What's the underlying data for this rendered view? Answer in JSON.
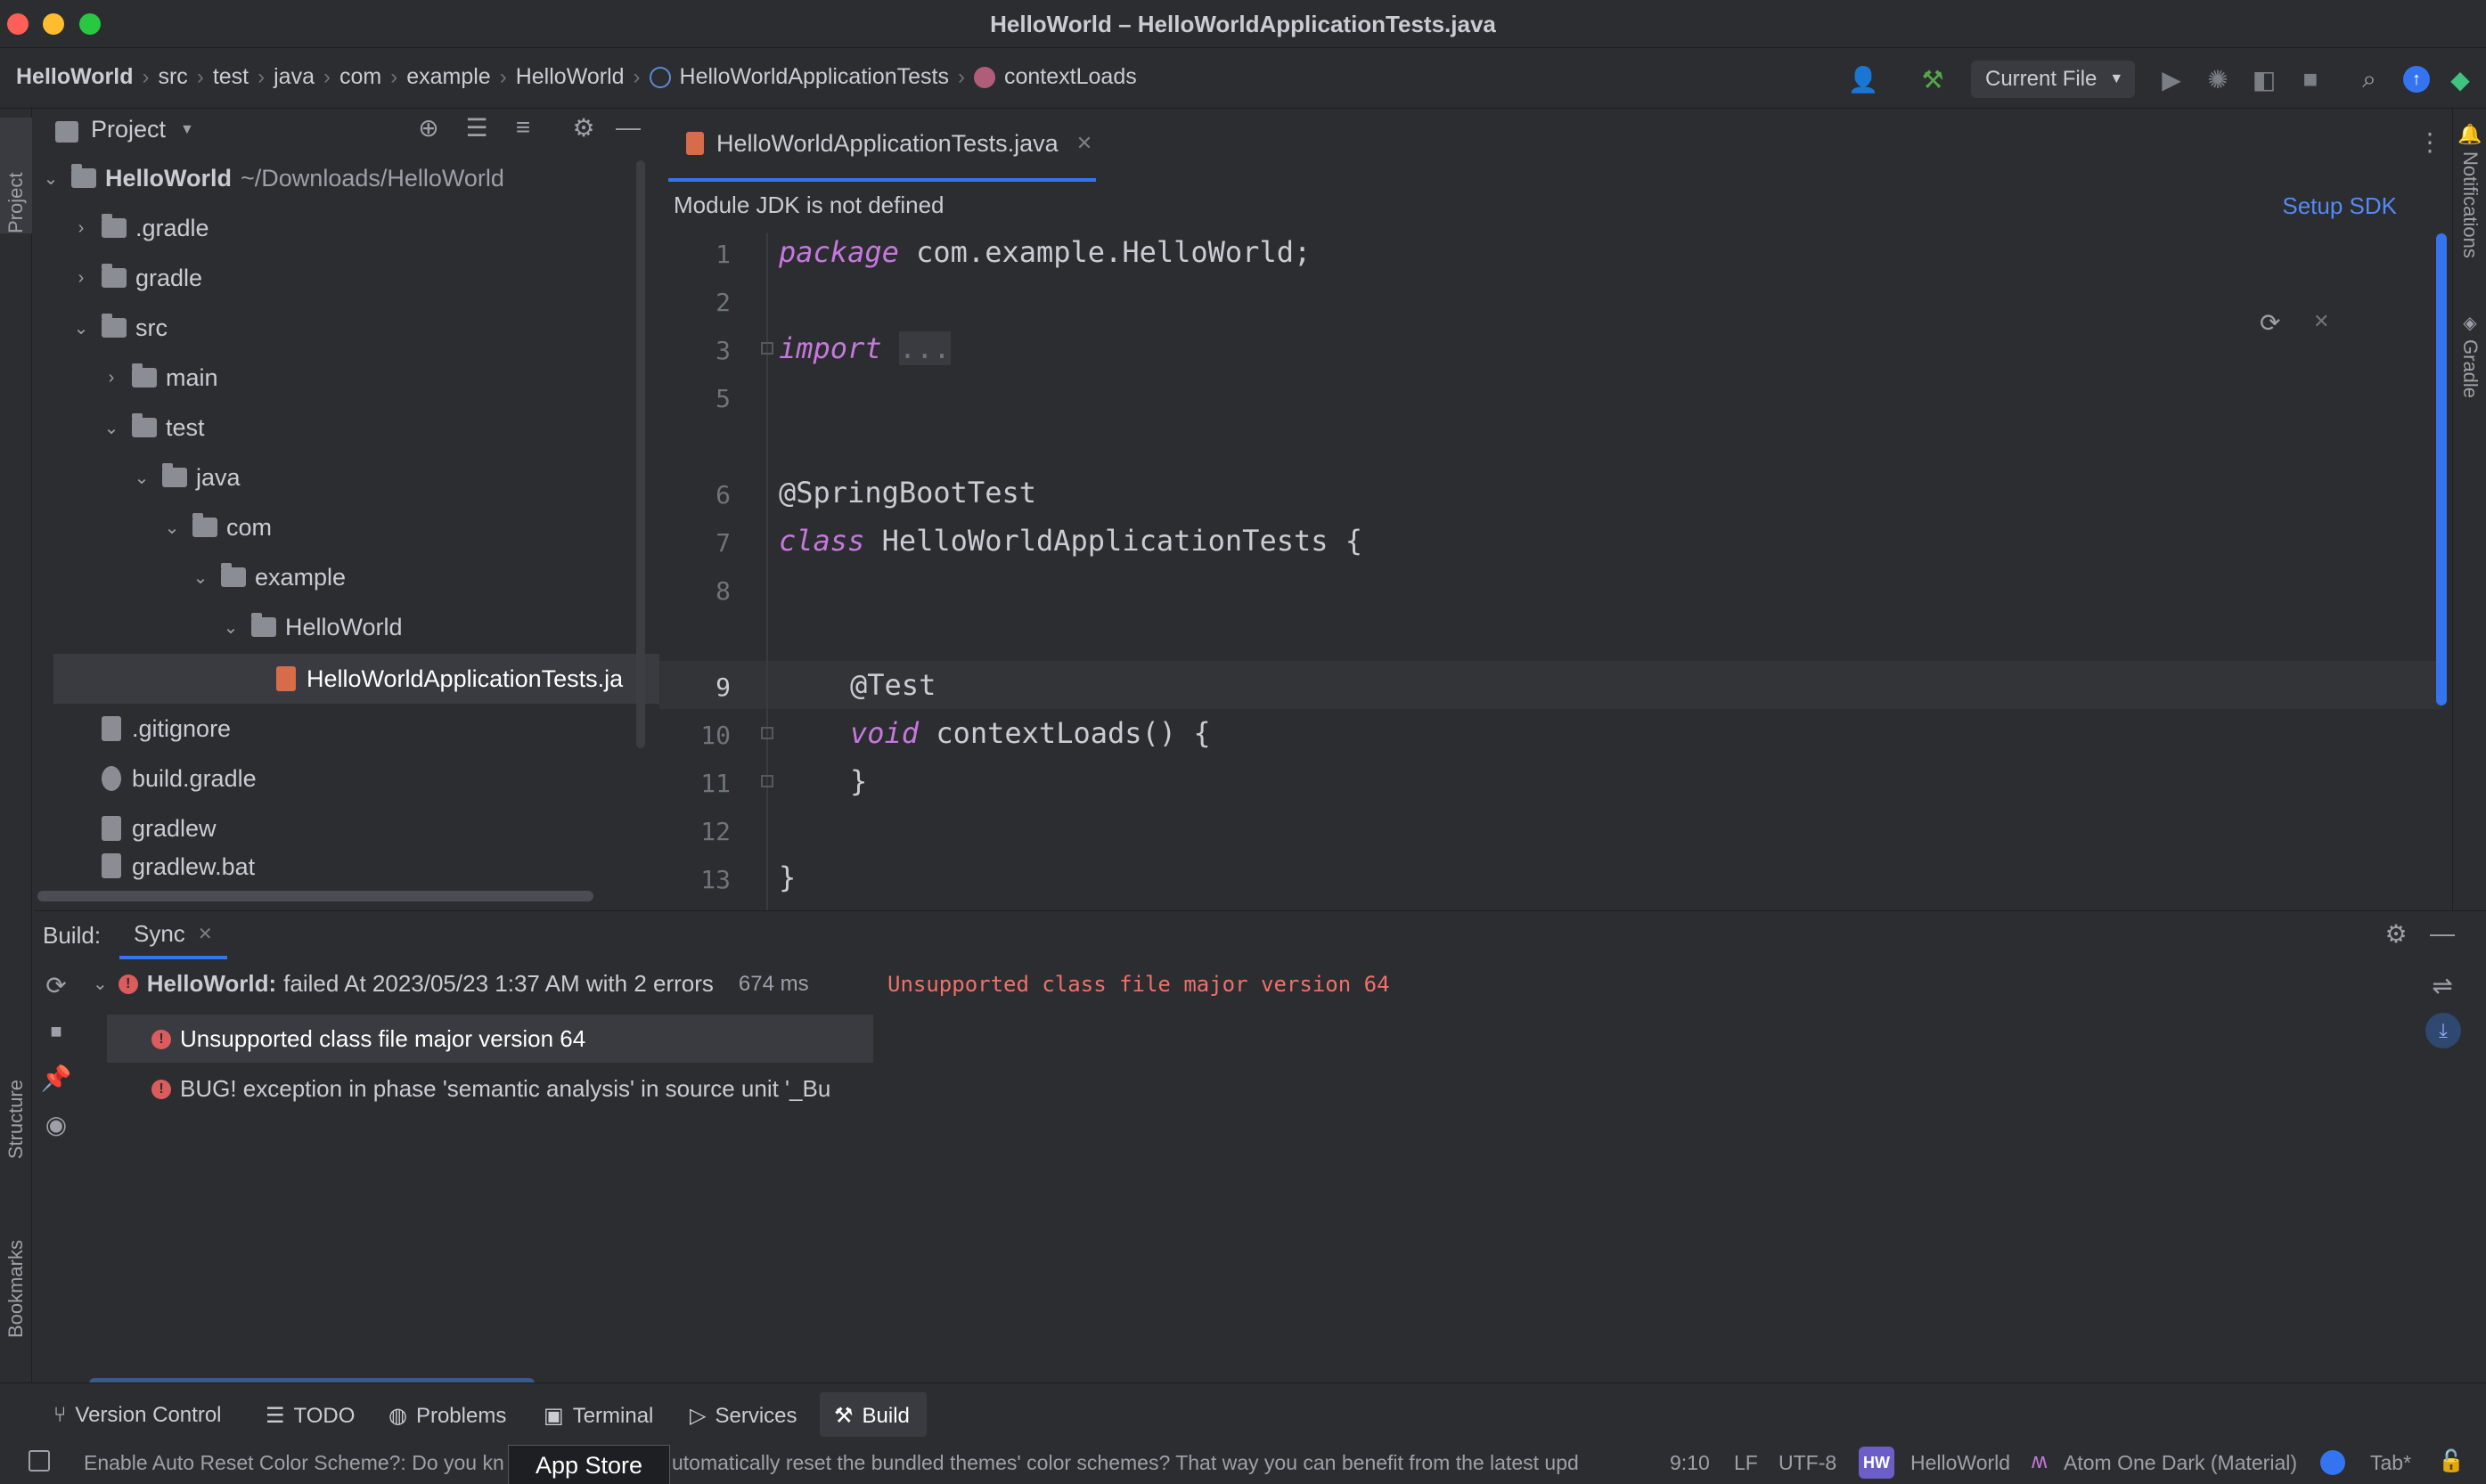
{
  "window": {
    "title": "HelloWorld – HelloWorldApplicationTests.java",
    "colors": {
      "close": "#fe5f57",
      "minimize": "#febc2e",
      "maximize": "#28c840",
      "accent": "#3574f0",
      "keyword": "#c678dd",
      "error": "#db5c5c"
    }
  },
  "breadcrumbs": [
    "HelloWorld",
    "src",
    "test",
    "java",
    "com",
    "example",
    "HelloWorld",
    "HelloWorldApplicationTests",
    "contextLoads"
  ],
  "toolbar": {
    "run_config": "Current File"
  },
  "project": {
    "title": "Project",
    "root_name": "HelloWorld",
    "root_path": "~/Downloads/HelloWorld",
    "tree": [
      ".gradle",
      "gradle",
      "src",
      "main",
      "test",
      "java",
      "com",
      "example",
      "HelloWorld",
      "HelloWorldApplicationTests.ja",
      ".gitignore",
      "build.gradle",
      "gradlew",
      "gradlew.bat"
    ]
  },
  "editor": {
    "tab_label": "HelloWorldApplicationTests.java",
    "banner_text": "Module JDK is not defined",
    "banner_action": "Setup SDK",
    "line_numbers": [
      "1",
      "2",
      "3",
      "5",
      "6",
      "7",
      "8",
      "9",
      "10",
      "11",
      "12",
      "13"
    ],
    "code": {
      "l1_kw": "package",
      "l1_rest": "com.example.HelloWorld;",
      "l3_kw": "import",
      "l3_rest": "...",
      "l6": "@SpringBootTest",
      "l7_kw": "class",
      "l7_rest": "HelloWorldApplicationTests {",
      "l9": "@Test",
      "l10_kw": "void",
      "l10_rest": "contextLoads() {",
      "l11": "}",
      "l13": "}"
    }
  },
  "build": {
    "label": "Build:",
    "tab": "Sync",
    "root_name": "HelloWorld:",
    "root_status": "failed At 2023/05/23 1:37 AM with 2 errors",
    "duration": "674 ms",
    "error_message": "Unsupported class file major version 64",
    "errors": [
      "Unsupported class file major version 64",
      "BUG! exception in phase 'semantic analysis' in source unit '_Bu"
    ]
  },
  "left_strip": {
    "project": "Project",
    "structure": "Structure",
    "bookmarks": "Bookmarks"
  },
  "right_strip": {
    "notifications": "Notifications",
    "gradle": "Gradle"
  },
  "tool_windows": [
    "Version Control",
    "TODO",
    "Problems",
    "Terminal",
    "Services",
    "Build"
  ],
  "status": {
    "message_start": "Enable Auto Reset Color Scheme?: Do you kn",
    "tooltip": "App Store",
    "message_end": "utomatically reset the bundled themes' color schemes? That way you can benefit from the latest upd",
    "position": "9:10",
    "line_sep": "LF",
    "encoding": "UTF-8",
    "project_badge": "HW",
    "project": "HelloWorld",
    "theme": "Atom One Dark (Material)",
    "indent": "Tab*"
  }
}
